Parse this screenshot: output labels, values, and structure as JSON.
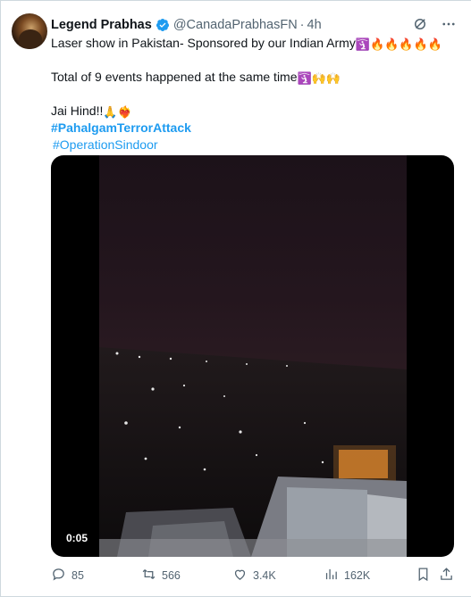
{
  "tweet": {
    "author_name": "Legend Prabhas",
    "handle": "@CanadaPrabhasFN",
    "separator": "·",
    "time": "4h",
    "line1": "Laser show in Pakistan- Sponsored by our Indian Army",
    "line1_emoji": "🛐🔥🔥🔥🔥🔥",
    "line2": "Total of 9 events happened at the same time",
    "line2_emoji": "🛐🙌🙌",
    "line3": "Jai Hind!!",
    "line3_emoji": "🙏❤️‍🔥",
    "hashtag1": "#PahalgamTerrorAttack",
    "hashtag2": "#OperationSindoor"
  },
  "media": {
    "duration": "0:05"
  },
  "actions": {
    "replies": "85",
    "reposts": "566",
    "likes": "3.4K",
    "views": "162K"
  },
  "icons": [
    "verified-badge-icon",
    "grok-icon",
    "more-icon",
    "reply-icon",
    "repost-icon",
    "like-icon",
    "views-icon",
    "bookmark-icon",
    "share-icon"
  ],
  "colors": {
    "accent": "#1d9bf0",
    "muted": "#536471",
    "text": "#0f1419"
  }
}
